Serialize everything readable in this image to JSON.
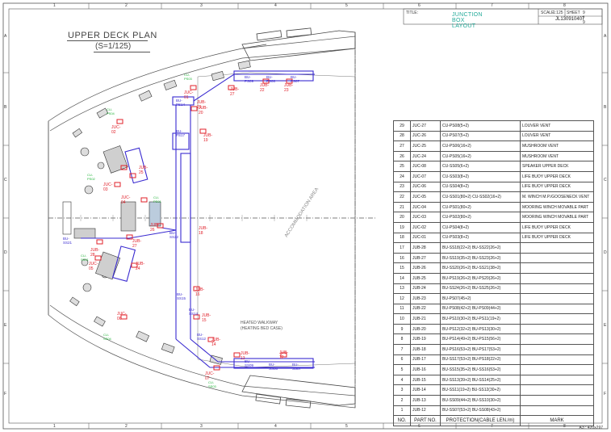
{
  "drawing": {
    "title": "UPPER DECK PLAN",
    "scale": "(S=1/125)",
    "area_label": "ACCOMMODATION AREA",
    "walkway_note_1": "HEATED WALKWAY",
    "walkway_note_2": "(HEATING BED CASE)"
  },
  "title_block": {
    "title_label": "TITLE:",
    "title_value": "JUNCTION BOX LAYOUT",
    "scale_label": "SCALE",
    "scale_value": "1:125",
    "sheet_label": "SHEET",
    "sheet_value": "9 / 9",
    "drawing_no": "JL130910407"
  },
  "paper_size": "A3 : 420x297",
  "grid_numbers_top": [
    "1",
    "2",
    "3",
    "4",
    "5",
    "6",
    "7",
    "8"
  ],
  "grid_letters_side": [
    "A",
    "B",
    "C",
    "D",
    "E",
    "F"
  ],
  "mark_table": {
    "headers": {
      "no": "NO.",
      "part": "PART NO.",
      "protection": "PROTECTION(CABLE LEN./m)",
      "mark": "MARK"
    },
    "rows": [
      {
        "no": "29",
        "part": "JUC-27",
        "prot": "CU-PS08(5+2)",
        "mark": "LOUVER VENT"
      },
      {
        "no": "28",
        "part": "JUC-26",
        "prot": "CU-PS07(5+2)",
        "mark": "LOUVER VENT"
      },
      {
        "no": "27",
        "part": "JUC-25",
        "prot": "CU-PS06(16+2)",
        "mark": "MUSHROOM VENT"
      },
      {
        "no": "26",
        "part": "JUC-24",
        "prot": "CU-PS05(16+2)",
        "mark": "MUSHROOM VENT"
      },
      {
        "no": "25",
        "part": "JUC-08",
        "prot": "CU-SS05(6+2)",
        "mark": "SPEAKER UPPER DECK"
      },
      {
        "no": "24",
        "part": "JUC-07",
        "prot": "CU-SS03(8+2)",
        "mark": "LIFE BUOY UPPER DECK"
      },
      {
        "no": "23",
        "part": "JUC-06",
        "prot": "CU-SS04(8+2)",
        "mark": "LIFE BUOY UPPER DECK"
      },
      {
        "no": "22",
        "part": "JUC-05",
        "prot": "CU-SS01(80+2)   CU-SS02(16+2)",
        "mark": "M. WINCH M.P./GOOSENECK VENT"
      },
      {
        "no": "21",
        "part": "JUC-04",
        "prot": "CU-PS01(80+2)",
        "mark": "MOORING WINCH MOVABLE PART"
      },
      {
        "no": "20",
        "part": "JUC-03",
        "prot": "CU-PS02(80+2)",
        "mark": "MOORING WINCH MOVABLE PART"
      },
      {
        "no": "19",
        "part": "JUC-02",
        "prot": "CU-PS04(8+2)",
        "mark": "LIFE BUOY UPPER DECK"
      },
      {
        "no": "18",
        "part": "JUC-01",
        "prot": "CU-PS03(8+2)",
        "mark": "LIFE BUOY UPPER DECK"
      },
      {
        "no": "17",
        "part": "JUB-28",
        "prot": "BU-SS18(22+2)   BU-SS22(26+2)",
        "mark": ""
      },
      {
        "no": "16",
        "part": "JUB-27",
        "prot": "BU-SS19(35+2)   BU-SS23(26+2)",
        "mark": ""
      },
      {
        "no": "15",
        "part": "JUB-26",
        "prot": "BU-SS20(26+2)   BU-SS21(38+2)",
        "mark": ""
      },
      {
        "no": "14",
        "part": "JUB-25",
        "prot": "BU-PS19(26+2)   BU-PS20(26+2)",
        "mark": ""
      },
      {
        "no": "13",
        "part": "JUB-24",
        "prot": "BU-SS24(26+2)   BU-SS25(26+2)",
        "mark": ""
      },
      {
        "no": "12",
        "part": "JUB-23",
        "prot": "BU-PS07(45+2)",
        "mark": ""
      },
      {
        "no": "11",
        "part": "JUB-22",
        "prot": "BU-PS08(42+2)   BU-PS09(44+2)",
        "mark": ""
      },
      {
        "no": "10",
        "part": "JUB-21",
        "prot": "BU-PS10(30+2)   BU-PS11(19+2)",
        "mark": ""
      },
      {
        "no": "9",
        "part": "JUB-20",
        "prot": "BU-PS12(32+2)   BU-PS13(30+2)",
        "mark": ""
      },
      {
        "no": "8",
        "part": "JUB-19",
        "prot": "BU-PS14(49+2)   BU-PS15(56+2)",
        "mark": ""
      },
      {
        "no": "7",
        "part": "JUB-18",
        "prot": "BU-PS16(53+2)   BU-PS17(53+2)",
        "mark": ""
      },
      {
        "no": "6",
        "part": "JUB-17",
        "prot": "BU-SS17(53+2)   BU-PS18(22+2)",
        "mark": ""
      },
      {
        "no": "5",
        "part": "JUB-16",
        "prot": "BU-SS15(35+2)   BU-SS16(53+2)",
        "mark": ""
      },
      {
        "no": "4",
        "part": "JUB-15",
        "prot": "BU-SS13(39+2)   BU-SS14(25+2)",
        "mark": ""
      },
      {
        "no": "3",
        "part": "JUB-14",
        "prot": "BU-SS11(19+2)   BU-SS12(30+2)",
        "mark": ""
      },
      {
        "no": "2",
        "part": "JUB-13",
        "prot": "BU-SS09(44+2)   BU-SS10(30+2)",
        "mark": ""
      },
      {
        "no": "1",
        "part": "JUB-12",
        "prot": "BU-SS07(53+2)   BU-SS08(43+2)",
        "mark": ""
      }
    ]
  },
  "plan_labels": {
    "jub": [
      {
        "text": "JUB-27"
      },
      {
        "text": "JUB-22"
      },
      {
        "text": "JUB-23"
      },
      {
        "text": "JUB-21"
      },
      {
        "text": "JUB-20"
      },
      {
        "text": "JUB-19"
      },
      {
        "text": "JUB-25"
      },
      {
        "text": "JUB-26"
      },
      {
        "text": "JUB-27"
      },
      {
        "text": "JUB-28"
      },
      {
        "text": "JUB-24"
      },
      {
        "text": "JUB-18"
      },
      {
        "text": "JUB-16"
      },
      {
        "text": "JUB-15"
      },
      {
        "text": "JUB-14"
      },
      {
        "text": "JUB-13"
      },
      {
        "text": "JUB-12"
      }
    ],
    "juc": [
      {
        "text": "JUC-01"
      },
      {
        "text": "JUC-02"
      },
      {
        "text": "JUC-03"
      },
      {
        "text": "JUC-04"
      },
      {
        "text": "JUC-05"
      },
      {
        "text": "JUC-06"
      },
      {
        "text": "JUC-07"
      }
    ],
    "bu": [
      {
        "text": "BU-PS09"
      },
      {
        "text": "BU-PS08"
      },
      {
        "text": "BU-PS07"
      },
      {
        "text": "BU-PS14"
      },
      {
        "text": "BU-PS17"
      },
      {
        "text": "BU-SS21"
      },
      {
        "text": "BU-SS22"
      },
      {
        "text": "BU-SS15"
      },
      {
        "text": "BU-SS14"
      },
      {
        "text": "BU-SS12"
      },
      {
        "text": "BU-SS09"
      },
      {
        "text": "BU-SS08"
      },
      {
        "text": "BU-SS07"
      }
    ],
    "cu": [
      {
        "text": "CU-PS03"
      },
      {
        "text": "CU-PS04"
      },
      {
        "text": "CU-PS02"
      },
      {
        "text": "CU-PS01"
      },
      {
        "text": "CU-SS01"
      },
      {
        "text": "CU-SS04"
      },
      {
        "text": "CU-SS03"
      }
    ]
  },
  "colors": {
    "box": "#e0202a",
    "cable": "#3a2bd0",
    "cu_text": "#22b33a",
    "line": "#555555",
    "title_green": "#2aa890"
  }
}
